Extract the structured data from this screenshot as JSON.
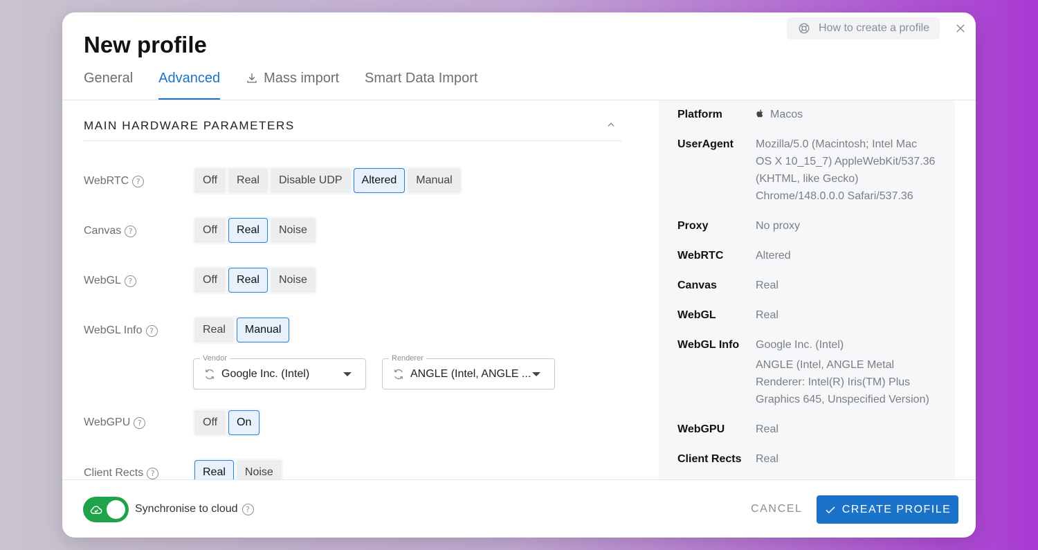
{
  "title": "New profile",
  "help_button": "How to create a profile",
  "tabs": [
    {
      "label": "General"
    },
    {
      "label": "Advanced"
    },
    {
      "label": "Mass import"
    },
    {
      "label": "Smart Data Import"
    }
  ],
  "section_title": "MAIN HARDWARE PARAMETERS",
  "rows": {
    "webrtc": {
      "label": "WebRTC",
      "options": [
        "Off",
        "Real",
        "Disable UDP",
        "Altered",
        "Manual"
      ],
      "selected": "Altered"
    },
    "canvas": {
      "label": "Canvas",
      "options": [
        "Off",
        "Real",
        "Noise"
      ],
      "selected": "Real"
    },
    "webgl": {
      "label": "WebGL",
      "options": [
        "Off",
        "Real",
        "Noise"
      ],
      "selected": "Real"
    },
    "webgl_info": {
      "label": "WebGL Info",
      "options": [
        "Real",
        "Manual"
      ],
      "selected": "Manual"
    },
    "webgpu": {
      "label": "WebGPU",
      "options": [
        "Off",
        "On"
      ],
      "selected": "On"
    },
    "client_rects": {
      "label": "Client Rects",
      "options": [
        "Real",
        "Noise"
      ],
      "selected": "Real"
    }
  },
  "vendor": {
    "label": "Vendor",
    "value": "Google Inc. (Intel)"
  },
  "renderer": {
    "label": "Renderer",
    "value": "ANGLE (Intel, ANGLE ..."
  },
  "summary": {
    "platform": {
      "key": "Platform",
      "value": "Macos"
    },
    "useragent": {
      "key": "UserAgent",
      "value": "Mozilla/5.0 (Macintosh; Intel Mac OS X 10_15_7) AppleWebKit/537.36 (KHTML, like Gecko) Chrome/148.0.0.0 Safari/537.36"
    },
    "proxy": {
      "key": "Proxy",
      "value": "No proxy"
    },
    "webrtc": {
      "key": "WebRTC",
      "value": "Altered"
    },
    "canvas": {
      "key": "Canvas",
      "value": "Real"
    },
    "webgl": {
      "key": "WebGL",
      "value": "Real"
    },
    "webgl_info": {
      "key": "WebGL Info",
      "vendor": "Google Inc. (Intel)",
      "renderer": "ANGLE (Intel, ANGLE Metal Renderer: Intel(R) Iris(TM) Plus Graphics 645, Unspecified Version)"
    },
    "webgpu": {
      "key": "WebGPU",
      "value": "Real"
    },
    "client_rects": {
      "key": "Client Rects",
      "value": "Real"
    }
  },
  "footer": {
    "sync_label": "Synchronise to cloud",
    "sync_on": true,
    "cancel": "CANCEL",
    "create": "CREATE PROFILE"
  },
  "colors": {
    "accent": "#1a73c8",
    "toggle": "#1fa34a"
  }
}
